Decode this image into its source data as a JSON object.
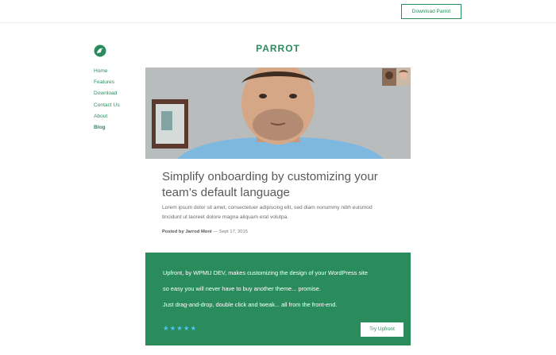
{
  "header": {
    "download_label": "Download Parrot"
  },
  "brand": {
    "name": "PARROT"
  },
  "sidebar": {
    "items": [
      {
        "label": "Home"
      },
      {
        "label": "Features"
      },
      {
        "label": "Download"
      },
      {
        "label": "Contact Us"
      },
      {
        "label": "About"
      },
      {
        "label": "Blog",
        "active": true
      }
    ]
  },
  "post": {
    "title": "Simplify onboarding by customizing your team’s default language",
    "excerpt": "Lorem ipsum dolor sit amet, consectetuer adipiscing elit, sed diam nonummy nibh euismod tincidunt ut laoreet dolore magna aliquam erat volutpa.",
    "author_label": "Posted by Jarrod Moré",
    "date_label": "— Sept 17, 2015"
  },
  "promo": {
    "line1": "Upfront, by WPMU DEV,  makes customizing the design of your WordPress site",
    "line2": "so easy you will never have to buy another theme... promise.",
    "line3": "Just drag-and-drop, double click and tweak... all from the front-end.",
    "stars": "★★★★★",
    "rating": 5,
    "button_label": "Try Upfront"
  },
  "colors": {
    "accent": "#2a8c5c",
    "stars": "#50c3f2"
  }
}
